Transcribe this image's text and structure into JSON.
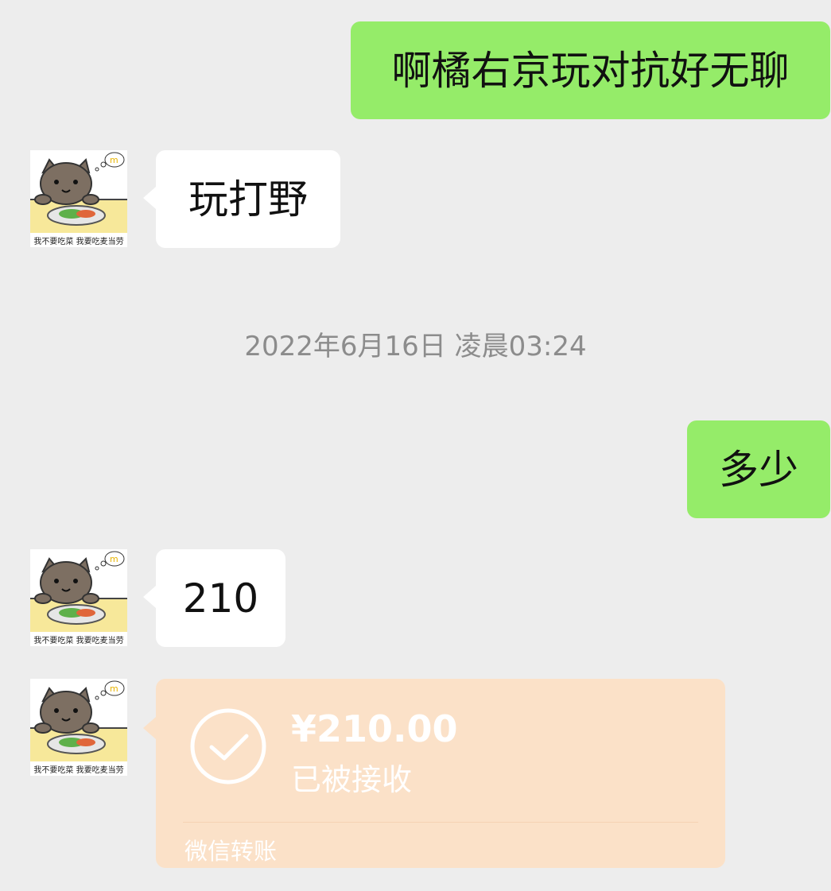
{
  "messages": [
    {
      "side": "out",
      "text": "啊橘右京玩对抗好无聊"
    },
    {
      "side": "in",
      "text": "玩打野"
    },
    {
      "side": "out",
      "text": "多少"
    },
    {
      "side": "in",
      "text": "210"
    }
  ],
  "timestamp": "2022年6月16日 凌晨03:24",
  "avatar": {
    "caption": "我不要吃菜 我要吃麦当劳",
    "icon": "cat-eating-avatar"
  },
  "transfer": {
    "amount": "¥210.00",
    "status": "已被接收",
    "label": "微信转账",
    "icon": "check-circle-icon"
  },
  "colors": {
    "background": "#ededed",
    "outgoing_bubble": "#95ec69",
    "incoming_bubble": "#ffffff",
    "transfer_card": "#fbe1c8"
  }
}
